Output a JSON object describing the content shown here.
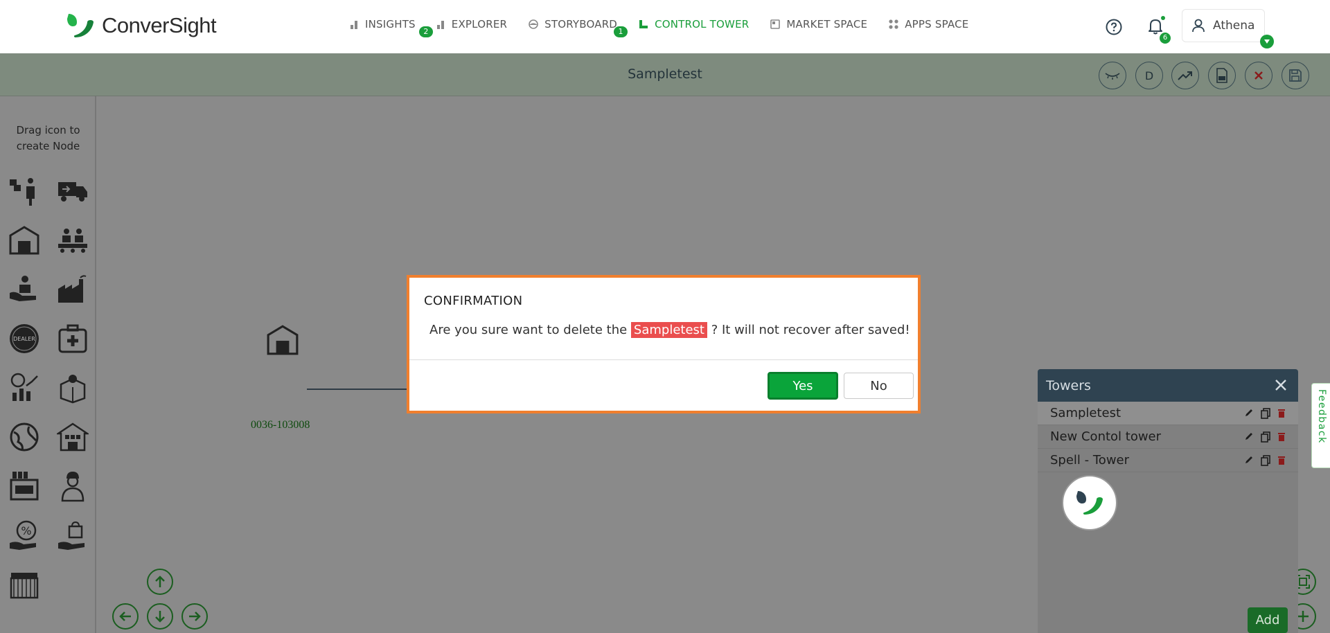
{
  "brand": {
    "name": "ConverSight"
  },
  "nav": {
    "items": [
      {
        "label": "INSIGHTS",
        "icon": "bar-chart-icon",
        "badge": "2"
      },
      {
        "label": "EXPLORER",
        "icon": "bar-chart-icon"
      },
      {
        "label": "STORYBOARD",
        "icon": "storyboard-icon",
        "badge": "1"
      },
      {
        "label": "CONTROL TOWER",
        "icon": "tower-icon",
        "active": true
      },
      {
        "label": "MARKET SPACE",
        "icon": "market-icon"
      },
      {
        "label": "APPS SPACE",
        "icon": "apps-grid-icon"
      }
    ],
    "notifications_count": "6",
    "user_name": "Athena"
  },
  "toolbar": {
    "title": "Sampletest",
    "design_label": "D"
  },
  "sidebar": {
    "hint_line1": "Drag icon to",
    "hint_line2": "create Node"
  },
  "canvas": {
    "node_label": "0036-103008"
  },
  "towers": {
    "header": "Towers",
    "items": [
      {
        "name": "Sampletest",
        "selected": true
      },
      {
        "name": "New Contol tower"
      },
      {
        "name": "Spell - Tower"
      }
    ],
    "add_label": "Add"
  },
  "feedback": {
    "label": "Feedback"
  },
  "dialog": {
    "title": "CONFIRMATION",
    "msg_before": "Are you sure want to delete the ",
    "msg_name": "Sampletest",
    "msg_after": " ? It will not recover after saved!",
    "yes_label": "Yes",
    "no_label": "No"
  },
  "colors": {
    "accent": "#1a9e3b",
    "dialog_border": "#f07f2e",
    "highlight": "#ea4e4e",
    "panel_header": "#2f4351"
  }
}
